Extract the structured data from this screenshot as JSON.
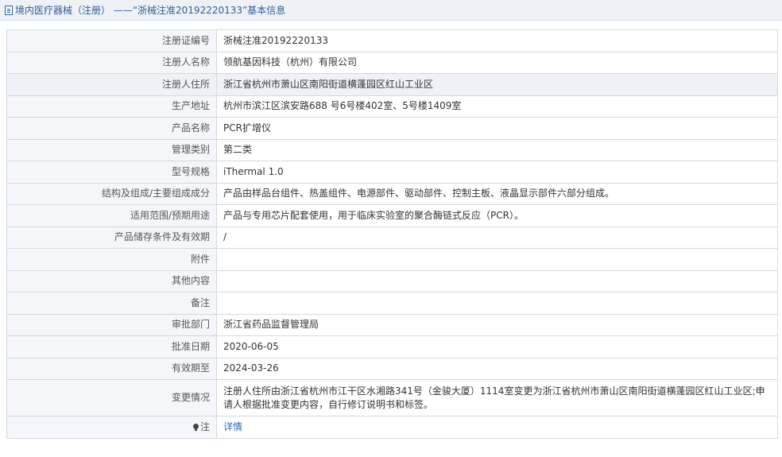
{
  "header": {
    "icon": "document-icon",
    "title": "境内医疗器械（注册） ——“浙械注准20192220133”基本信息"
  },
  "rows": [
    {
      "label": "注册证编号",
      "value": "浙械注准20192220133"
    },
    {
      "label": "注册人名称",
      "value": "领航基因科技（杭州）有限公司"
    },
    {
      "label": "注册人住所",
      "value": "浙江省杭州市萧山区南阳街道横蓬园区红山工业区"
    },
    {
      "label": "生产地址",
      "value": "杭州市滨江区滨安路688 号6号楼402室、5号楼1409室"
    },
    {
      "label": "产品名称",
      "value": "PCR扩增仪"
    },
    {
      "label": "管理类别",
      "value": "第二类"
    },
    {
      "label": "型号规格",
      "value": "iThermal 1.0"
    },
    {
      "label": "结构及组成/主要组成成分",
      "value": "产品由样品台组件、热盖组件、电源部件、驱动部件、控制主板、液晶显示部件六部分组成。"
    },
    {
      "label": "适用范围/预期用途",
      "value": "产品与专用芯片配套使用，用于临床实验室的聚合酶链式反应（PCR）。"
    },
    {
      "label": "产品储存条件及有效期",
      "value": "/"
    },
    {
      "label": "附件",
      "value": ""
    },
    {
      "label": "其他内容",
      "value": ""
    },
    {
      "label": "备注",
      "value": ""
    },
    {
      "label": "审批部门",
      "value": "浙江省药品监督管理局"
    },
    {
      "label": "批准日期",
      "value": "2020-06-05"
    },
    {
      "label": "有效期至",
      "value": "2024-03-26"
    },
    {
      "label": "变更情况",
      "value": "注册人住所由浙江省杭州市江干区水湘路341号（金骏大厦）1114室变更为浙江省杭州市萧山区南阳街道横蓬园区红山工业区;申请人根据批准变更内容，自行修订说明书和标签。"
    }
  ],
  "note": {
    "icon": "lightbulb-icon",
    "label": "注",
    "link_text": "详情"
  }
}
